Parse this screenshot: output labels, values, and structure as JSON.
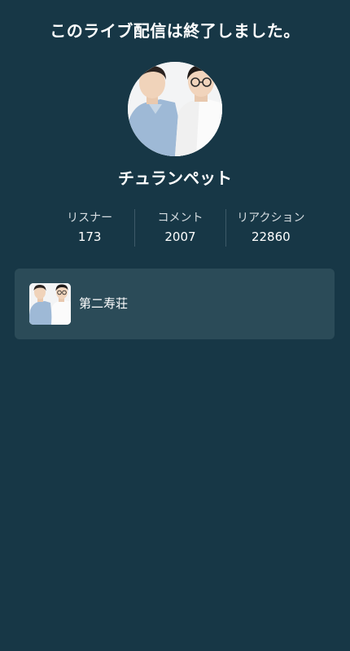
{
  "header": {
    "ended_message": "このライブ配信は終了しました。"
  },
  "channel": {
    "name": "チュランペット",
    "avatar_icon": "performer-duo-photo"
  },
  "stats": [
    {
      "label": "リスナー",
      "value": "173"
    },
    {
      "label": "コメント",
      "value": "2007"
    },
    {
      "label": "リアクション",
      "value": "22860"
    }
  ],
  "program": {
    "title": "第二寿荘",
    "thumbnail_icon": "performer-duo-photo"
  },
  "colors": {
    "background": "#173746",
    "card": "#2b4b58",
    "divider": "#3d5a68",
    "text": "#ffffff"
  }
}
